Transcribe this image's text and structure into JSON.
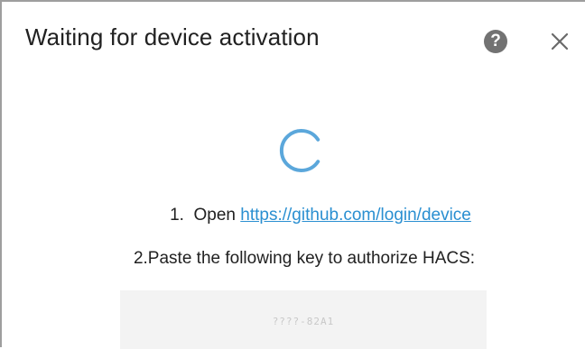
{
  "dialog": {
    "title": "Waiting for device activation",
    "help_icon": "question-circle-icon",
    "help_glyph": "?",
    "close_icon": "close-x-icon"
  },
  "steps": {
    "step1_prefix": "1.  Open ",
    "step1_link": "https://github.com/login/device",
    "step2_text": "2.Paste the following key to authorize HACS:"
  },
  "key": {
    "value": "????-82A1"
  },
  "colors": {
    "accent": "#2a8fd1",
    "spinner": "#5ba7db",
    "help_bg": "#727272"
  }
}
